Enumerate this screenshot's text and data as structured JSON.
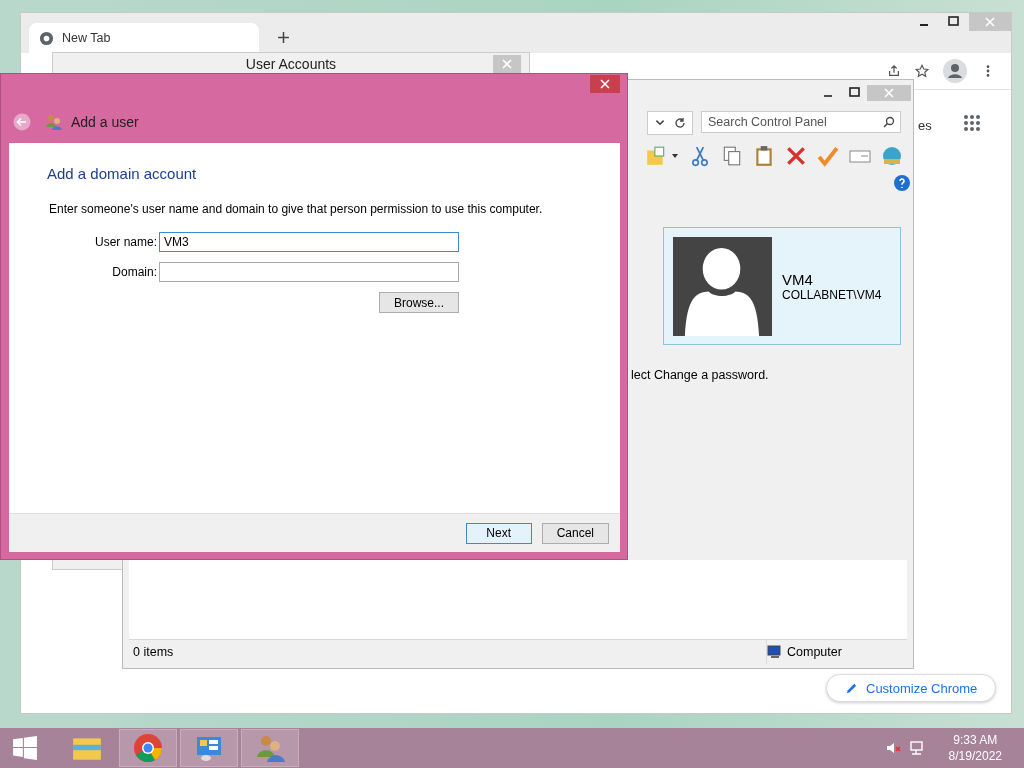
{
  "browser": {
    "tabs": [
      {
        "label": "New Tab",
        "selected": true
      }
    ],
    "customize_button": "Customize Chrome",
    "partial_text": "es"
  },
  "user_accounts_window": {
    "title": "User Accounts"
  },
  "control_panel": {
    "search": {
      "placeholder": "Search Control Panel"
    },
    "user_tile": {
      "name": "VM4",
      "account": "COLLABNET\\VM4"
    },
    "hint": "lect Change a password.",
    "status_bar": {
      "items": "0 items",
      "location": "Computer"
    }
  },
  "dialog": {
    "title": "Add a user",
    "heading": "Add a domain account",
    "instructions": "Enter someone's user name and domain to give that person permission to use this computer.",
    "fields": [
      {
        "label": "User name:",
        "value": "VM3",
        "focused": true
      },
      {
        "label": "Domain:",
        "focused": false
      }
    ],
    "browse_button": "Browse...",
    "buttons": [
      {
        "label": "Next",
        "default": true
      },
      {
        "label": "Cancel",
        "default": false
      }
    ]
  },
  "taskbar": {
    "apps": [
      {
        "kind": "explorer",
        "open": false
      },
      {
        "kind": "chrome",
        "open": true
      },
      {
        "kind": "control-panel",
        "open": true
      },
      {
        "kind": "users",
        "open": true
      }
    ],
    "time": "9:33 AM",
    "date": "8/19/2022"
  }
}
